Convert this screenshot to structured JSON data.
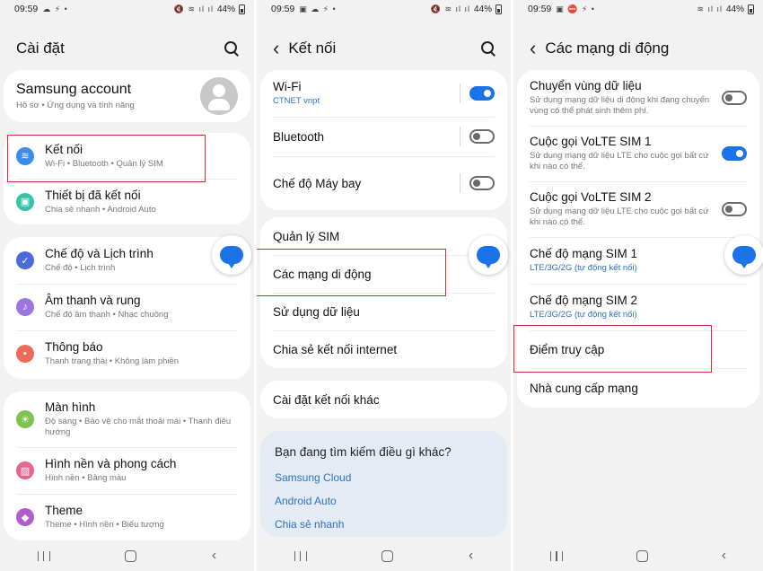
{
  "status": {
    "s1": {
      "time": "09:59",
      "battery": "44%"
    },
    "s2": {
      "time": "09:59",
      "battery": "44%"
    },
    "s3": {
      "time": "09:59",
      "battery": "44%"
    }
  },
  "screen1": {
    "title": "Cài đặt",
    "account": {
      "title": "Samsung account",
      "sub": "Hồ sơ  •  Ứng dụng và tính năng"
    },
    "items": [
      {
        "title": "Kết nối",
        "sub": "Wi-Fi  •  Bluetooth  •  Quản lý SIM",
        "icon": "wifi-icon",
        "color": "#3b8bea"
      },
      {
        "title": "Thiết bị đã kết nối",
        "sub": "Chia sẻ nhanh  •  Android Auto",
        "icon": "connected-devices-icon",
        "color": "#34c3a8"
      },
      {
        "title": "Chế độ và Lịch trình",
        "sub": "Chế độ  •  Lịch trình",
        "icon": "modes-icon",
        "color": "#4b6cd8"
      },
      {
        "title": "Âm thanh và rung",
        "sub": "Chế độ âm thanh  •  Nhạc chuông",
        "icon": "sound-icon",
        "color": "#9a78e0"
      },
      {
        "title": "Thông báo",
        "sub": "Thanh trạng thái  •  Không làm phiền",
        "icon": "notifications-icon",
        "color": "#f06a5b"
      },
      {
        "title": "Màn hình",
        "sub": "Độ sáng  •  Bảo vệ cho mắt thoải mái  •  Thanh điều hướng",
        "icon": "display-icon",
        "color": "#7cc44e"
      },
      {
        "title": "Hình nền và phong cách",
        "sub": "Hình nền  •  Bảng màu",
        "icon": "wallpaper-icon",
        "color": "#e4658f"
      },
      {
        "title": "Theme",
        "sub": "Theme  •  Hình nền  •  Biểu tượng",
        "icon": "theme-icon",
        "color": "#b25cc9"
      }
    ]
  },
  "screen2": {
    "title": "Kết nối",
    "wifi": {
      "title": "Wi-Fi",
      "sub": "CTNET vnpt"
    },
    "bluetooth": "Bluetooth",
    "airplane": "Chế độ Máy bay",
    "sim": "Quản lý SIM",
    "mobile_networks": "Các mạng di động",
    "data_usage": "Sử dụng dữ liệu",
    "hotspot": "Chia sẻ kết nối internet",
    "more": "Cài đặt kết nối khác",
    "suggest": {
      "title": "Bạn đang tìm kiếm điều gì khác?",
      "links": [
        "Samsung Cloud",
        "Android Auto",
        "Chia sẻ nhanh"
      ]
    }
  },
  "screen3": {
    "title": "Các mạng di động",
    "items": [
      {
        "title": "Chuyển vùng dữ liệu",
        "sub": "Sử dụng mạng dữ liệu di động khi đang chuyển vùng có thể phát sinh thêm phí."
      },
      {
        "title": "Cuộc gọi VoLTE SIM 1",
        "sub": "Sử dụng mạng dữ liệu LTE cho cuộc gọi bất cứ khi nào có thể."
      },
      {
        "title": "Cuộc gọi VoLTE SIM 2",
        "sub": "Sử dụng mạng dữ liệu LTE cho cuộc gọi bất cứ khi nào có thể."
      },
      {
        "title": "Chế độ mạng SIM 1",
        "sub": "LTE/3G/2G (tự động kết nối)"
      },
      {
        "title": "Chế độ mạng SIM 2",
        "sub": "LTE/3G/2G (tự động kết nối)"
      },
      {
        "title": "Điểm truy cập",
        "sub": ""
      },
      {
        "title": "Nhà cung cấp mạng",
        "sub": ""
      }
    ]
  }
}
